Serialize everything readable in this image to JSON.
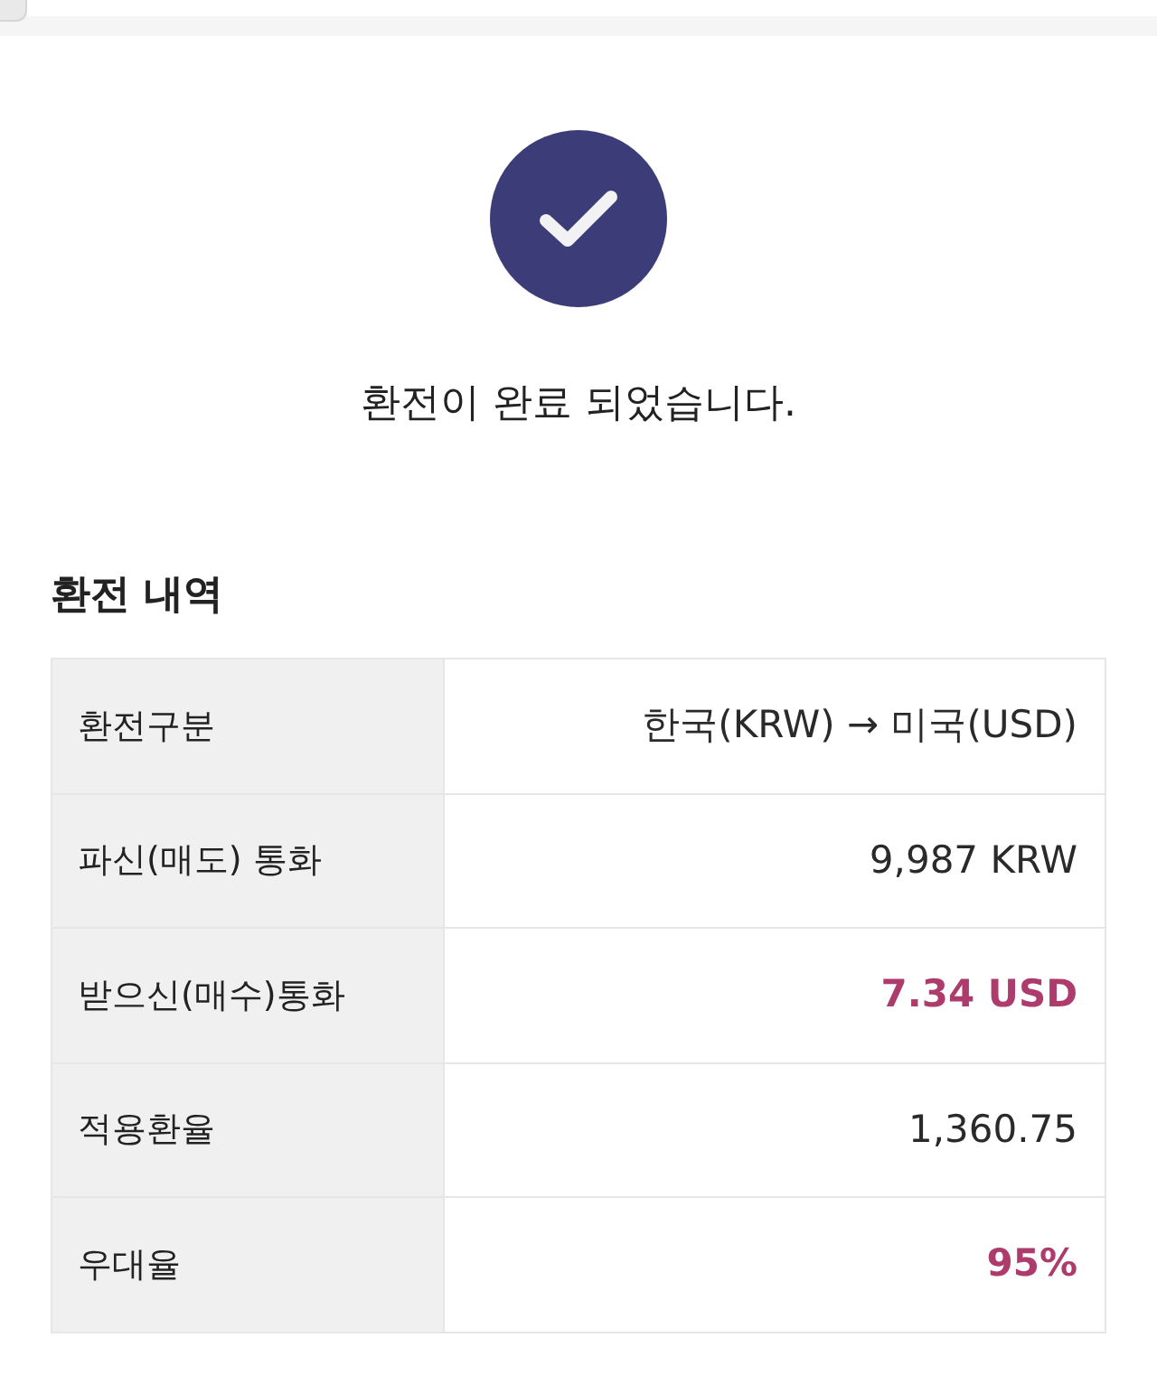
{
  "status_message": "환전이 완료 되었습니다.",
  "section_title": "환전 내역",
  "details": [
    {
      "label": "환전구분",
      "value": "한국(KRW) → 미국(USD)",
      "highlighted": false
    },
    {
      "label": "파신(매도) 통화",
      "value": "9,987 KRW",
      "highlighted": false
    },
    {
      "label": "받으신(매수)통화",
      "value": "7.34 USD",
      "highlighted": true
    },
    {
      "label": "적용환율",
      "value": "1,360.75",
      "highlighted": false
    },
    {
      "label": "우대율",
      "value": "95%",
      "highlighted": true
    }
  ]
}
